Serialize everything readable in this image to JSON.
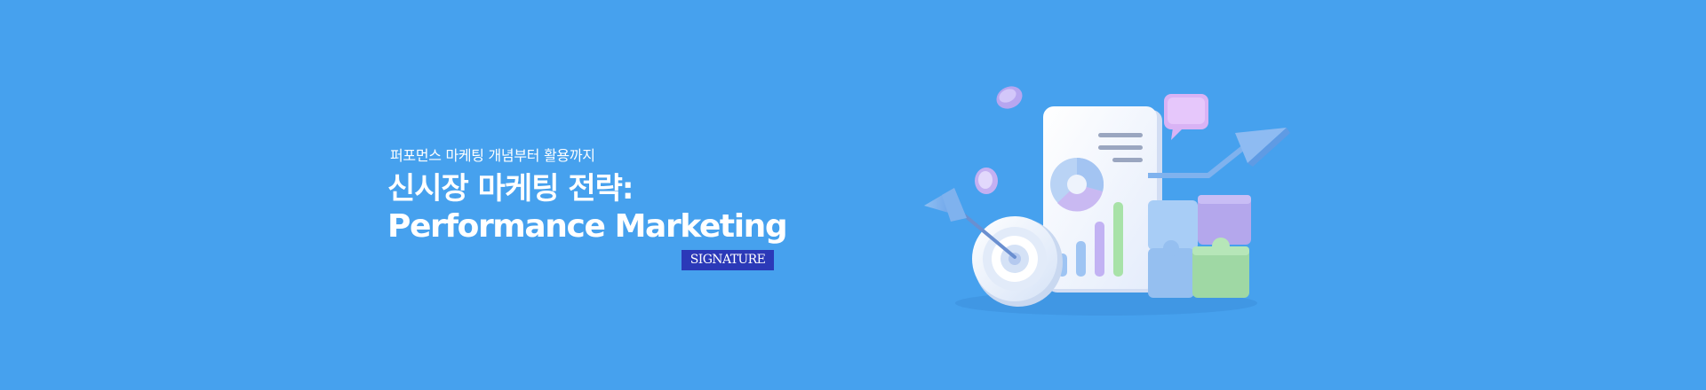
{
  "banner": {
    "background": "#46a1ee",
    "subtitle": "퍼포먼스 마케팅 개념부터 활용까지",
    "title_ko": "신시장 마케팅 전략:",
    "title_en": "Performance Marketing",
    "badge": {
      "label": "SIGNATURE",
      "color": "#2b39b8"
    }
  },
  "illustration": {
    "icons": [
      "target-icon",
      "arrow-icon",
      "report-document-icon",
      "pie-chart-icon",
      "bar-chart-icon",
      "puzzle-icon",
      "speech-bubble-icon",
      "trend-arrow-icon",
      "coin-icon"
    ]
  }
}
